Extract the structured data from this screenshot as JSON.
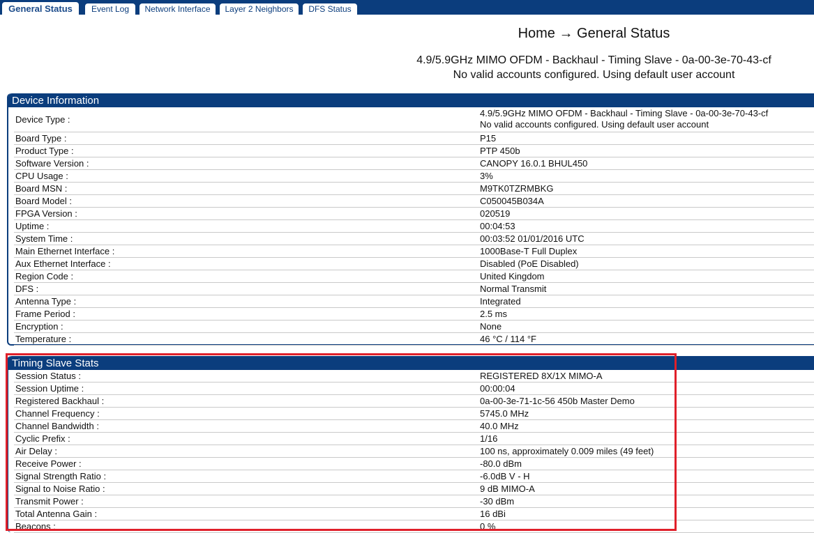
{
  "tabs": [
    {
      "label": "General Status",
      "active": true
    },
    {
      "label": "Event Log"
    },
    {
      "label": "Network Interface"
    },
    {
      "label": "Layer 2 Neighbors"
    },
    {
      "label": "DFS Status"
    }
  ],
  "header": {
    "title": "Home → General Status",
    "subtitle": "4.9/5.9GHz MIMO OFDM - Backhaul - Timing Slave - 0a-00-3e-70-43-cf",
    "notice": "No valid accounts configured. Using default user account"
  },
  "device_info": {
    "title": "Device Information",
    "device_type": {
      "label": "Device Type :",
      "line1": "4.9/5.9GHz MIMO OFDM - Backhaul - Timing Slave - 0a-00-3e-70-43-cf",
      "line2": "No valid accounts configured. Using default user account"
    },
    "rows": [
      {
        "label": "Board Type :",
        "value": "P15"
      },
      {
        "label": "Product Type :",
        "value": "PTP 450b"
      },
      {
        "label": "Software Version :",
        "value": "CANOPY 16.0.1 BHUL450"
      },
      {
        "label": "CPU Usage :",
        "value": "3%"
      },
      {
        "label": "Board MSN :",
        "value": "M9TK0TZRMBKG"
      },
      {
        "label": "Board Model :",
        "value": "C050045B034A"
      },
      {
        "label": "FPGA Version :",
        "value": "020519"
      },
      {
        "label": "Uptime :",
        "value": "00:04:53"
      },
      {
        "label": "System Time :",
        "value": "00:03:52 01/01/2016 UTC"
      },
      {
        "label": "Main Ethernet Interface :",
        "value": "1000Base-T Full Duplex"
      },
      {
        "label": "Aux Ethernet Interface :",
        "value": "Disabled (PoE Disabled)"
      },
      {
        "label": "Region Code :",
        "value": "United Kingdom"
      },
      {
        "label": "DFS :",
        "value": "Normal Transmit"
      },
      {
        "label": "Antenna Type :",
        "value": "Integrated"
      },
      {
        "label": "Frame Period :",
        "value": "2.5 ms"
      },
      {
        "label": "Encryption :",
        "value": "None"
      },
      {
        "label": "Temperature :",
        "value": "46 °C / 114 °F"
      }
    ]
  },
  "timing_stats": {
    "title": "Timing Slave Stats",
    "rows": [
      {
        "label": "Session Status :",
        "value": "REGISTERED 8X/1X MIMO-A"
      },
      {
        "label": "Session Uptime :",
        "value": "00:00:04"
      },
      {
        "label": "Registered Backhaul :",
        "value": "0a-00-3e-71-1c-56 450b Master Demo"
      },
      {
        "label": "Channel Frequency :",
        "value": "5745.0 MHz"
      },
      {
        "label": "Channel Bandwidth :",
        "value": "40.0 MHz"
      },
      {
        "label": "Cyclic Prefix :",
        "value": "1/16"
      },
      {
        "label": "Air Delay :",
        "value": "100 ns, approximately 0.009 miles (49 feet)"
      },
      {
        "label": "Receive Power :",
        "value": "-80.0 dBm"
      },
      {
        "label": "Signal Strength Ratio :",
        "value": "-6.0dB V - H"
      },
      {
        "label": "Signal to Noise Ratio :",
        "value": "9 dB MIMO-A"
      },
      {
        "label": "Transmit Power :",
        "value": "-30 dBm"
      },
      {
        "label": "Total Antenna Gain :",
        "value": "16 dBi"
      },
      {
        "label": "Beacons :",
        "value": "0 %"
      }
    ]
  }
}
